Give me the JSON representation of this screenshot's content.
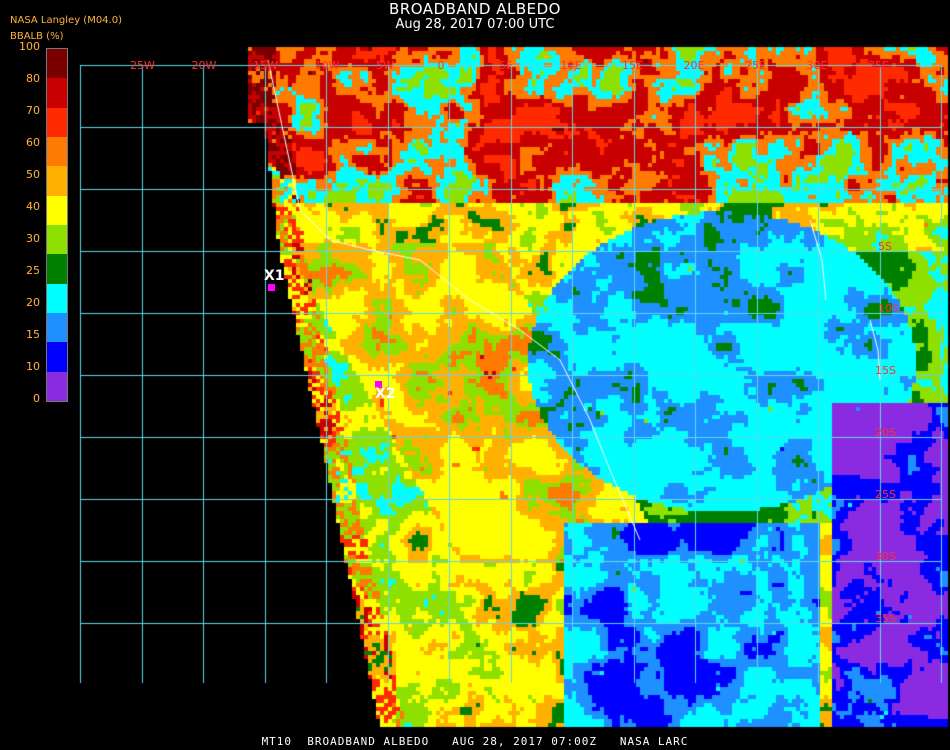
{
  "header": {
    "title": "BROADBAND ALBEDO",
    "subtitle": "Aug 28, 2017 07:00 UTC",
    "org": "NASA Langley (M04.0)",
    "unit": "BBALB (%)"
  },
  "legend": {
    "ticks": [
      "100",
      "80",
      "70",
      "60",
      "50",
      "40",
      "30",
      "25",
      "20",
      "15",
      "10",
      "0"
    ],
    "colors": [
      "#7a0000",
      "#c80000",
      "#ff2a00",
      "#ff7a00",
      "#ffb000",
      "#ffff00",
      "#8ee000",
      "#008000",
      "#00ffff",
      "#1e90ff",
      "#0000ff",
      "#8a2be2"
    ]
  },
  "grid": {
    "lon_labels": [
      "25W",
      "20W",
      "15W",
      "10W",
      "5W",
      "0",
      "5E",
      "10E",
      "15E",
      "20E",
      "25E",
      "30E",
      "35E"
    ],
    "lat_labels": [
      "5S",
      "10S",
      "15S",
      "20S",
      "25S",
      "30S",
      "35S"
    ],
    "line_color": "#5fd8e8",
    "label_color": "#ff3030"
  },
  "markers": [
    {
      "label": "X1"
    },
    {
      "label": "X2"
    }
  ],
  "footer": "MT10  BROADBAND ALBEDO   AUG 28, 2017 07:00Z   NASA LARC"
}
